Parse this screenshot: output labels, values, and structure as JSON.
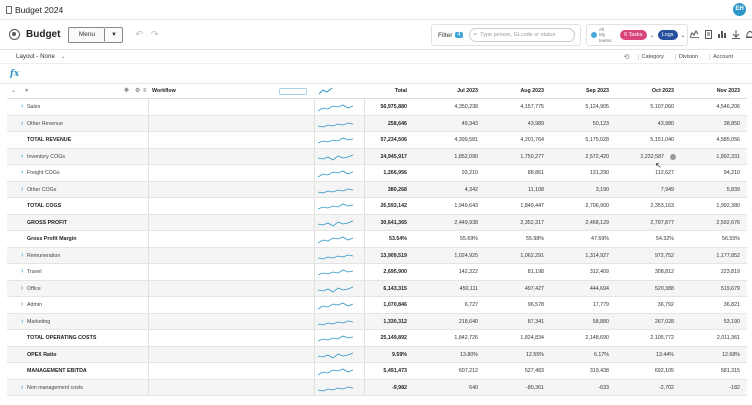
{
  "window": {
    "title": "Budget 2024",
    "avatar_initials": "EH"
  },
  "toolbar": {
    "app_name": "Budget",
    "menu_label": "Menu",
    "filter_label": "Filter",
    "filter_count": "4",
    "search_placeholder": "Type person, GLcode or status",
    "all_users_label": "All\nMy teams",
    "tasks_label": "6 Tasks",
    "logs_label": "Logs"
  },
  "layout": {
    "label": "Layout - None",
    "dimensions": [
      "Category",
      "Division",
      "Account"
    ]
  },
  "grid": {
    "workflow_header": "Workflow",
    "columns": [
      "Total",
      "Jul 2023",
      "Aug 2023",
      "Sep 2023",
      "Oct 2023",
      "Nov 2023"
    ],
    "rows": [
      {
        "label": "Sales",
        "expandable": true,
        "total": false,
        "values": [
          "56,975,880",
          "4,350,238",
          "4,157,775",
          "5,124,905",
          "5,107,060",
          "4,546,206"
        ]
      },
      {
        "label": "Other Revenue",
        "expandable": true,
        "total": false,
        "values": [
          "258,646",
          "49,343",
          "43,989",
          "50,123",
          "43,980",
          "38,850"
        ]
      },
      {
        "label": "TOTAL REVENUE",
        "expandable": false,
        "total": true,
        "values": [
          "57,234,506",
          "4,399,581",
          "4,201,764",
          "5,175,028",
          "5,151,040",
          "4,585,056"
        ]
      },
      {
        "label": "Inventory COGs",
        "expandable": true,
        "total": false,
        "values": [
          "24,945,917",
          "1,852,090",
          "1,750,277",
          "2,572,420",
          "2,232,587",
          "1,892,331"
        ],
        "comment_col": 4
      },
      {
        "label": "Freight COGs",
        "expandable": true,
        "total": false,
        "values": [
          "1,266,956",
          "93,210",
          "88,861",
          "131,290",
          "112,627",
          "94,210"
        ]
      },
      {
        "label": "Other COGs",
        "expandable": true,
        "total": false,
        "values": [
          "380,268",
          "4,342",
          "11,108",
          "3,190",
          "7,949",
          "5,839"
        ]
      },
      {
        "label": "TOTAL COGS",
        "expandable": false,
        "total": true,
        "values": [
          "26,593,142",
          "1,949,643",
          "1,849,447",
          "2,706,900",
          "2,353,163",
          "1,992,380"
        ]
      },
      {
        "label": "GROSS PROFIT",
        "expandable": false,
        "total": true,
        "values": [
          "30,641,365",
          "2,449,938",
          "2,352,317",
          "2,468,129",
          "2,797,877",
          "2,592,676"
        ]
      },
      {
        "label": "Gross Profit Margin",
        "expandable": false,
        "total": true,
        "values": [
          "53.54%",
          "55.69%",
          "55.98%",
          "47.69%",
          "54.32%",
          "56.55%"
        ]
      },
      {
        "label": "Remuneration",
        "expandable": true,
        "total": false,
        "values": [
          "13,909,519",
          "1,024,925",
          "1,062,291",
          "1,314,927",
          "972,752",
          "1,177,852"
        ]
      },
      {
        "label": "Travel",
        "expandable": true,
        "total": false,
        "values": [
          "2,695,900",
          "142,322",
          "81,198",
          "312,409",
          "308,812",
          "223,819"
        ]
      },
      {
        "label": "Office",
        "expandable": true,
        "total": false,
        "values": [
          "6,143,315",
          "450,111",
          "497,427",
          "444,694",
          "520,388",
          "519,679"
        ]
      },
      {
        "label": "Admin",
        "expandable": true,
        "total": false,
        "values": [
          "1,070,846",
          "6,727",
          "96,578",
          "17,779",
          "36,792",
          "36,821"
        ]
      },
      {
        "label": "Marketing",
        "expandable": true,
        "total": false,
        "values": [
          "1,330,312",
          "218,640",
          "87,341",
          "58,880",
          "267,028",
          "53,190"
        ]
      },
      {
        "label": "TOTAL OPERATING COSTS",
        "expandable": false,
        "total": true,
        "values": [
          "25,149,892",
          "1,842,726",
          "1,824,834",
          "2,148,690",
          "2,105,772",
          "2,011,361"
        ]
      },
      {
        "label": "OPEX Ratio",
        "expandable": false,
        "total": true,
        "values": [
          "9.59%",
          "13.80%",
          "12.55%",
          "6.17%",
          "13.44%",
          "12.68%"
        ]
      },
      {
        "label": "MANAGEMENT EBITDA",
        "expandable": false,
        "total": true,
        "values": [
          "5,491,473",
          "607,212",
          "527,483",
          "319,438",
          "692,105",
          "581,315"
        ]
      },
      {
        "label": "Non management costs",
        "expandable": true,
        "total": false,
        "values": [
          "-9,982",
          "640",
          "-80,361",
          "-633",
          "-2,702",
          "-182"
        ]
      }
    ]
  },
  "colors": {
    "accent": "#2e95c7",
    "tasks": "#d9457a",
    "logs": "#264f9e"
  }
}
